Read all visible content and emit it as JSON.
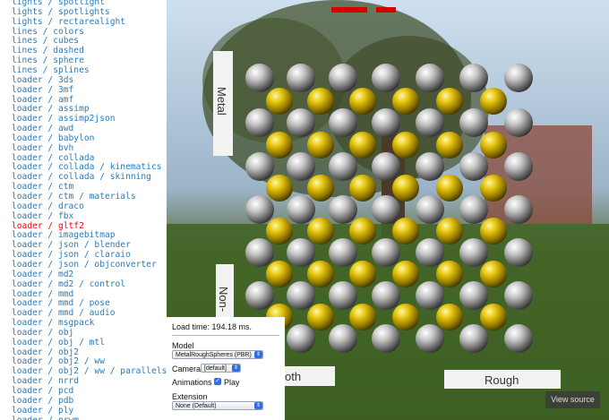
{
  "sidebar": {
    "selected_index": 23,
    "links": [
      "lights / spotlight",
      "lights / spotlights",
      "lights / rectarealight",
      "lines / colors",
      "lines / cubes",
      "lines / dashed",
      "lines / sphere",
      "lines / splines",
      "loader / 3ds",
      "loader / 3mf",
      "loader / amf",
      "loader / assimp",
      "loader / assimp2json",
      "loader / awd",
      "loader / babylon",
      "loader / bvh",
      "loader / collada",
      "loader / collada / kinematics",
      "loader / collada / skinning",
      "loader / ctm",
      "loader / ctm / materials",
      "loader / draco",
      "loader / fbx",
      "loader / gltf2",
      "loader / imagebitmap",
      "loader / json / blender",
      "loader / json / claraio",
      "loader / json / objconverter",
      "loader / md2",
      "loader / md2 / control",
      "loader / mmd",
      "loader / mmd / pose",
      "loader / mmd / audio",
      "loader / msgpack",
      "loader / obj",
      "loader / obj / mtl",
      "loader / obj2",
      "loader / obj2 / ww",
      "loader / obj2 / ww / parallels",
      "loader / nrrd",
      "loader / pcd",
      "loader / pdb",
      "loader / ply",
      "loader / prwm"
    ]
  },
  "viewport": {
    "label_metal": "Metal",
    "label_nonmetal": "Non-",
    "label_smooth": "oth",
    "label_rough": "Rough"
  },
  "panel": {
    "load_time": "Load time: 194.18 ms.",
    "model_label": "Model",
    "model_value": "MetalRoughSpheres (PBR)",
    "camera_label": "Camera",
    "camera_value": "[default]",
    "animations_label": "Animations",
    "play_label": "Play",
    "extension_label": "Extension",
    "extension_value": "None (Default)"
  },
  "view_source_label": "View source",
  "colors": {
    "link": "#2b7bb9",
    "selected_link": "#ff0000",
    "accent": "#2f6fe0"
  }
}
